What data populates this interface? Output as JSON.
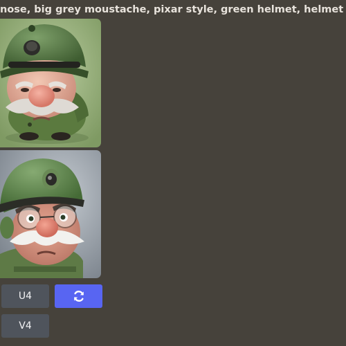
{
  "message": {
    "prompt_text": "nose, big grey moustache, pixar style, green helmet, helmet covering"
  },
  "images": [
    {
      "alt": "cartoon soldier with green helmet and grey moustache, variation 3"
    },
    {
      "alt": "cartoon soldier with green helmet, glasses and white moustache, variation 4"
    }
  ],
  "buttons": {
    "upscale_4": "U4",
    "variation_4": "V4",
    "reroll_icon": "refresh-icon"
  },
  "colors": {
    "background": "#46423b",
    "button_grey": "#4f545c",
    "button_blurple": "#5865f2"
  }
}
